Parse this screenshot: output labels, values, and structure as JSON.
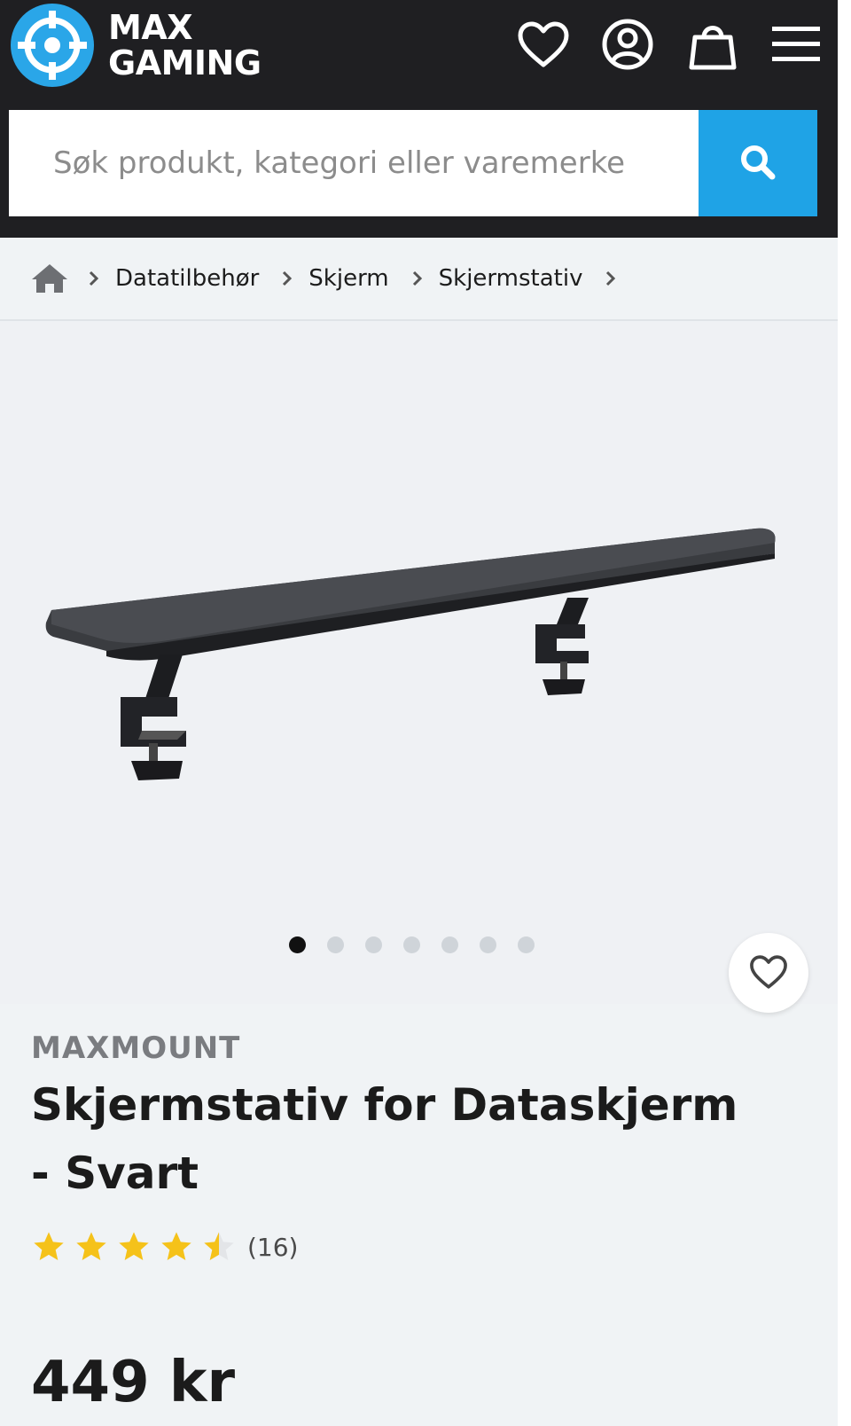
{
  "brand_logo": {
    "line1": "MAX",
    "line2": "GAMING"
  },
  "header_icons": [
    "heart-icon",
    "user-icon",
    "bag-icon",
    "menu-icon"
  ],
  "search": {
    "placeholder": "Søk produkt, kategori eller varemerke",
    "value": ""
  },
  "breadcrumb": [
    "Datatilbehør",
    "Skjerm",
    "Skjermstativ"
  ],
  "gallery": {
    "image_count": 7,
    "active_index": 0
  },
  "product": {
    "brand": "MAXMOUNT",
    "title": "Skjermstativ for Dataskjerm - Svart",
    "rating": 4.5,
    "reviews": "(16)",
    "price": "449 kr"
  },
  "colors": {
    "header_bg": "#1f1f22",
    "accent": "#1fa3e6",
    "star": "#f5c21a"
  }
}
